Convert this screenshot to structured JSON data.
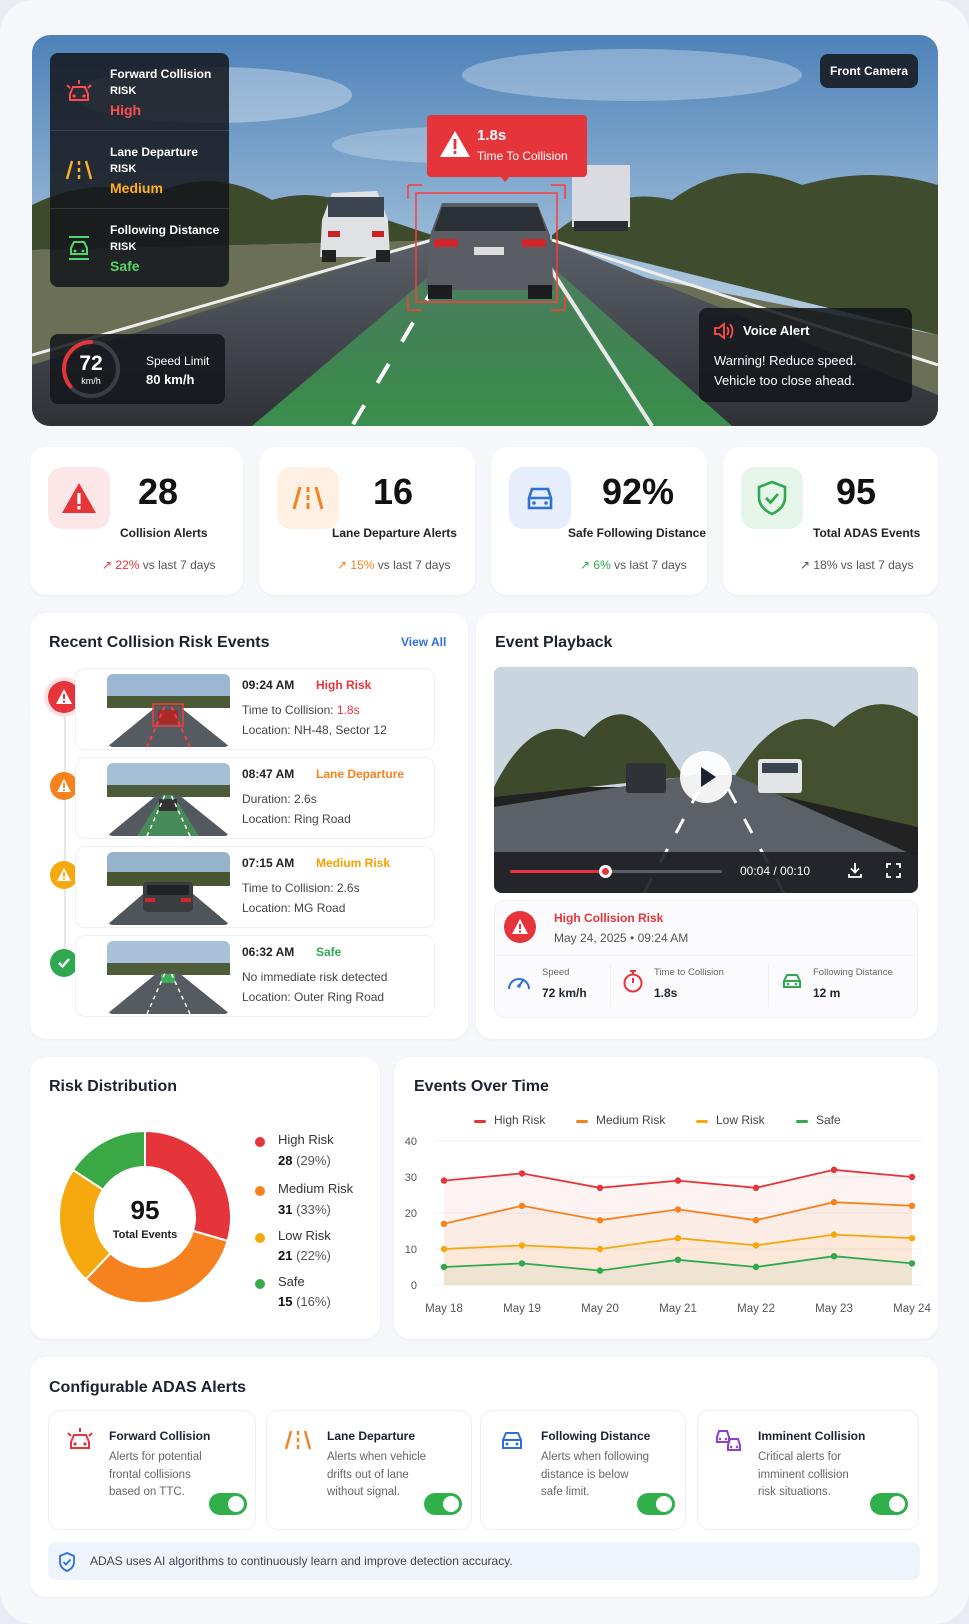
{
  "hero": {
    "camera_label": "Front Camera",
    "risks": [
      {
        "title": "Forward Collision",
        "sub": "RISK",
        "level": "High",
        "color": "#ff4d4d"
      },
      {
        "title": "Lane Departure",
        "sub": "RISK",
        "level": "Medium",
        "color": "#ffb020"
      },
      {
        "title": "Following Distance",
        "sub": "RISK",
        "level": "Safe",
        "color": "#56d66a"
      }
    ],
    "ttc_value": "1.8s",
    "ttc_label": "Time To Collision",
    "speed": "72",
    "speed_unit": "km/h",
    "speed_limit_label": "Speed Limit",
    "speed_limit_value": "80 km/h",
    "voice_title": "Voice Alert",
    "voice_line1": "Warning! Reduce speed.",
    "voice_line2": "Vehicle too close ahead."
  },
  "stats": [
    {
      "value": "28",
      "label": "Collision Alerts",
      "trend_pct": "22%",
      "trend_rest": " vs last 7 days",
      "color": "#e5343a",
      "icon": "warning-icon"
    },
    {
      "value": "16",
      "label": "Lane Departure Alerts",
      "trend_pct": "15%",
      "trend_rest": " vs last 7 days",
      "color": "#f5821f",
      "icon": "lane-icon"
    },
    {
      "value": "92%",
      "label": "Safe Following Distance",
      "trend_pct": "6%",
      "trend_rest": " vs last 7 days",
      "color": "#2fa84f",
      "icon": "car-icon"
    },
    {
      "value": "95",
      "label": "Total ADAS Events",
      "trend_pct": "18%",
      "trend_rest": " vs last 7 days",
      "color": "#2fa84f",
      "icon": "shield-check-icon"
    }
  ],
  "recent": {
    "title": "Recent Collision Risk Events",
    "view_all": "View All",
    "events": [
      {
        "time": "09:24 AM",
        "tag": "High Risk",
        "tag_color": "#e5343a",
        "line1": "Time to Collision: ",
        "line1_val": "1.8s",
        "line2": "Location: NH-48, Sector 12"
      },
      {
        "time": "08:47 AM",
        "tag": "Lane Departure",
        "tag_color": "#f5821f",
        "line1": "Duration: 2.6s",
        "line1_val": "",
        "line2": "Location: Ring Road"
      },
      {
        "time": "07:15 AM",
        "tag": "Medium Risk",
        "tag_color": "#f5a000",
        "line1": "Time to Collision: 2.6s",
        "line1_val": "",
        "line2": "Location: MG Road"
      },
      {
        "time": "06:32 AM",
        "tag": "Safe",
        "tag_color": "#2fa84f",
        "line1": "No immediate risk detected",
        "line1_val": "",
        "line2": "Location: Outer Ring Road"
      }
    ]
  },
  "playback": {
    "title": "Event Playback",
    "time": "00:04 / 00:10",
    "progress": 0.45,
    "risk_title": "High Collision Risk",
    "date": "May 24, 2025",
    "time_of_day": "09:24 AM",
    "metrics": [
      {
        "label": "Speed",
        "value": "72 km/h"
      },
      {
        "label": "Time to Collision",
        "value": "1.8s"
      },
      {
        "label": "Following Distance",
        "value": "12 m"
      }
    ]
  },
  "distribution": {
    "title": "Risk Distribution",
    "total": "95",
    "total_label": "Total Events",
    "items": [
      {
        "name": "High Risk",
        "count": "28",
        "pct": "(29%)",
        "value": 28,
        "color": "#e5343a"
      },
      {
        "name": "Medium Risk",
        "count": "31",
        "pct": "(33%)",
        "value": 31,
        "color": "#f5821f"
      },
      {
        "name": "Low Risk",
        "count": "21",
        "pct": "(22%)",
        "value": 21,
        "color": "#f5a90f"
      },
      {
        "name": "Safe",
        "count": "15",
        "pct": "(16%)",
        "value": 15,
        "color": "#3aa845"
      }
    ]
  },
  "chart_data": {
    "type": "line",
    "title": "Events Over Time",
    "x": [
      "May 18",
      "May 19",
      "May 20",
      "May 21",
      "May 22",
      "May 23",
      "May 24"
    ],
    "ylim": [
      0,
      40
    ],
    "yticks": [
      "0",
      "10",
      "20",
      "30",
      "40"
    ],
    "legend_position": "top",
    "series": [
      {
        "name": "High Risk",
        "color": "#e5343a",
        "values": [
          29,
          31,
          27,
          29,
          27,
          32,
          30
        ]
      },
      {
        "name": "Medium Risk",
        "color": "#f5821f",
        "values": [
          17,
          22,
          18,
          21,
          18,
          23,
          22
        ]
      },
      {
        "name": "Low Risk",
        "color": "#f5a90f",
        "values": [
          10,
          11,
          10,
          13,
          11,
          14,
          13
        ]
      },
      {
        "name": "Safe",
        "color": "#2fa84f",
        "values": [
          5,
          6,
          4,
          7,
          5,
          8,
          6
        ]
      }
    ]
  },
  "alerts": {
    "title": "Configurable ADAS Alerts",
    "items": [
      {
        "title": "Forward Collision",
        "d1": "Alerts for potential",
        "d2": "frontal collisions",
        "d3": "based on TTC.",
        "enabled": true
      },
      {
        "title": "Lane Departure",
        "d1": "Alerts when vehicle",
        "d2": "drifts out of lane",
        "d3": "without signal.",
        "enabled": true
      },
      {
        "title": "Following Distance",
        "d1": "Alerts when following",
        "d2": "distance is below",
        "d3": "safe limit.",
        "enabled": true
      },
      {
        "title": "Imminent Collision",
        "d1": "Critical alerts for",
        "d2": "imminent collision",
        "d3": "risk situations.",
        "enabled": true
      }
    ],
    "footer": "ADAS uses AI algorithms to continuously learn and improve detection accuracy."
  }
}
